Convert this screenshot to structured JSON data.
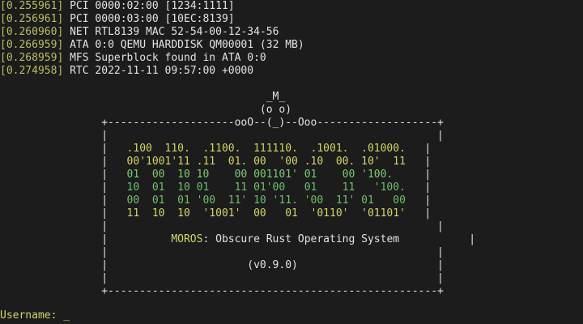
{
  "boot_log": [
    {
      "time": "[0.255961]",
      "text": "PCI 0000:02:00 [1234:1111]"
    },
    {
      "time": "[0.256961]",
      "text": "PCI 0000:03:00 [10EC:8139]"
    },
    {
      "time": "[0.260960]",
      "text": "NET RTL8139 MAC 52-54-00-12-34-56"
    },
    {
      "time": "[0.266959]",
      "text": "ATA 0:0 QEMU HARDDISK QM00001 (32 MB)"
    },
    {
      "time": "[0.268959]",
      "text": "MFS Superblock found in ATA 0:0"
    },
    {
      "time": "[0.274958]",
      "text": "RTC 2022-11-11 09:57:00 +0000"
    }
  ],
  "banner": {
    "head1": "                                          _M_",
    "head2": "                                         (o o)",
    "top_border": "                +--------------------ooO--(_)--Ooo-------------------+",
    "empty_row": "                |                                                    |",
    "logo": [
      "   .100  110.  .1100.  111110.  .1001.  .01000.   ",
      "   00'1001'11 .11  01. 00  '00 .10  00. 10'  11   ",
      "   01  00  10 10    00 001101' 01    00 '100.     ",
      "   10  01  10 01    11 01'00   01    11   '100.   ",
      "   00  01  01 '00  11' 10 '11. '00  11' 01   00   ",
      "   11  10  10  '1001'  00   01  '0110'  '01101'   "
    ],
    "title_prefix": "MOROS",
    "title_rest": ": Obscure Rust Operating System",
    "version": "(v0.9.0)",
    "bottom_border": "                +----------------------------------------------------+"
  },
  "prompt": {
    "label": "Username: ",
    "cursor": "_"
  }
}
